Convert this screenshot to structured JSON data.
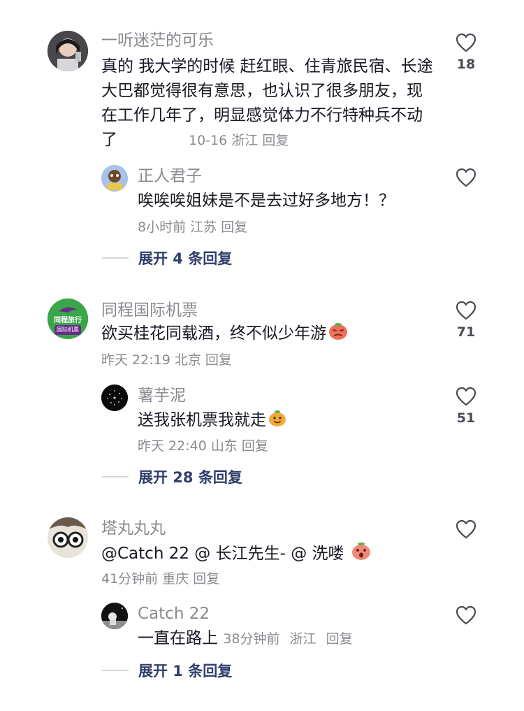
{
  "comments": [
    {
      "user": "一听迷茫的可乐",
      "text": "真的 我大学的时候 赶红眼、住青旅民宿、长途大巴都觉得很有意思，也认识了很多朋友，现在工作几年了，明显感觉体力不行特种兵不动了",
      "date": "10-16",
      "location": "浙江",
      "reply_label": "回复",
      "likes": "18",
      "replies": [
        {
          "user": "正人君子",
          "text": "唉唉唉姐妹是不是去过好多地方！？",
          "date": "8小时前",
          "location": "江苏",
          "reply_label": "回复",
          "likes": ""
        }
      ],
      "expand_label": "展开 4 条回复"
    },
    {
      "user": "同程国际机票",
      "avatar_text_top": "同程旅行",
      "avatar_text_bottom": "国际机票",
      "text": "欲买桂花同载酒，终不似少年游",
      "date": "昨天 22:19",
      "location": "北京",
      "reply_label": "回复",
      "likes": "71",
      "replies": [
        {
          "user": "薯芋泥",
          "text": "送我张机票我就走",
          "date": "昨天 22:40",
          "location": "山东",
          "reply_label": "回复",
          "likes": "51"
        }
      ],
      "expand_label": "展开 28 条回复"
    },
    {
      "user": "塔丸丸丸",
      "text": "@Catch 22 @ 长江先生- @ 洗喽",
      "date": "41分钟前",
      "location": "重庆",
      "reply_label": "回复",
      "likes": "",
      "replies": [
        {
          "user": "Catch 22",
          "text": "一直在路上",
          "date": "38分钟前",
          "location": "浙江",
          "reply_label": "回复",
          "likes": ""
        }
      ],
      "expand_label": "展开 1 条回复"
    }
  ],
  "colors": {
    "text": "#161823",
    "meta": "#8a8b91",
    "expand": "#2f3f6b",
    "brand_green": "#3aa64a",
    "brand_purple": "#6a2a8c"
  },
  "icons": {
    "like": "heart-outline-icon"
  }
}
